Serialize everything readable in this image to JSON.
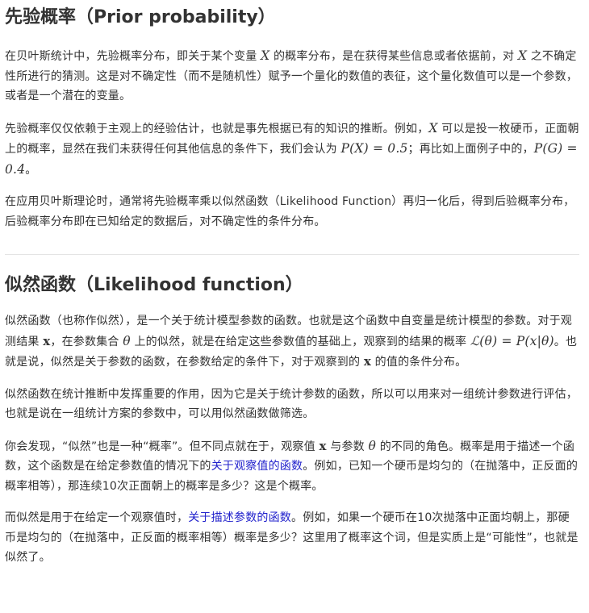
{
  "section1": {
    "title": "先验概率（Prior probability）",
    "p1": {
      "a": "在贝叶斯统计中，先验概率分布，即关于某个变量 ",
      "m1": "X",
      "b": " 的概率分布，是在获得某些信息或者依据前，对 ",
      "m2": "X",
      "c": " 之不确定性所进行的猜测。这是对不确定性（而不是随机性）赋予一个量化的数值的表征，这个量化数值可以是一个参数，或者是一个潜在的变量。"
    },
    "p2": {
      "a": "先验概率仅仅依赖于主观上的经验估计，也就是事先根据已有的知识的推断。例如，",
      "m1": "X",
      "b": " 可以是投一枚硬币，正面朝上的概率，显然在我们未获得任何其他信息的条件下，我们会认为 ",
      "m2": "P(X) = 0.5",
      "c": "；再比如上面例子中的，",
      "m3": "P(G) = 0.4",
      "d": "。"
    },
    "p3": "在应用贝叶斯理论时，通常将先验概率乘以似然函数（Likelihood Function）再归一化后，得到后验概率分布，后验概率分布即在已知给定的数据后，对不确定性的条件分布。"
  },
  "section2": {
    "title": "似然函数（Likelihood function）",
    "p1": {
      "a": "似然函数（也称作似然），是一个关于统计模型参数的函数。也就是这个函数中自变量是统计模型的参数。对于观测结果 ",
      "m1": "x",
      "b": "，在参数集合 ",
      "m2": "θ",
      "c": " 上的似然，就是在给定这些参数值的基础上，观察到的结果的概率 ",
      "m3": "ℒ(θ) = P(x|θ)",
      "d": "。也就是说，似然是关于参数的函数，在参数给定的条件下，对于观察到的 ",
      "m4": "x",
      "e": " 的值的条件分布。"
    },
    "p2": "似然函数在统计推断中发挥重要的作用，因为它是关于统计参数的函数，所以可以用来对一组统计参数进行评估，也就是说在一组统计方案的参数中，可以用似然函数做筛选。",
    "p3": {
      "a": "你会发现，“似然”也是一种“概率”。但不同点就在于，观察值 ",
      "m1": "x",
      "b": " 与参数 ",
      "m2": "θ",
      "c": " 的不同的角色。概率是用于描述一个函数，这个函数是在给定参数值的情况下的",
      "link": "关于观察值的函数",
      "d": "。例如，已知一个硬币是均匀的（在抛落中，正反面的概率相等），那连续10次正面朝上的概率是多少？这是个概率。"
    },
    "p4": {
      "a": "而似然是用于在给定一个观察值时，",
      "link": "关于描述参数的函数",
      "b": "。例如，如果一个硬币在10次抛落中正面均朝上，那硬币是均匀的（在抛落中，正反面的概率相等）概率是多少？这里用了概率这个词，但是实质上是“可能性”，也就是似然了。"
    }
  }
}
